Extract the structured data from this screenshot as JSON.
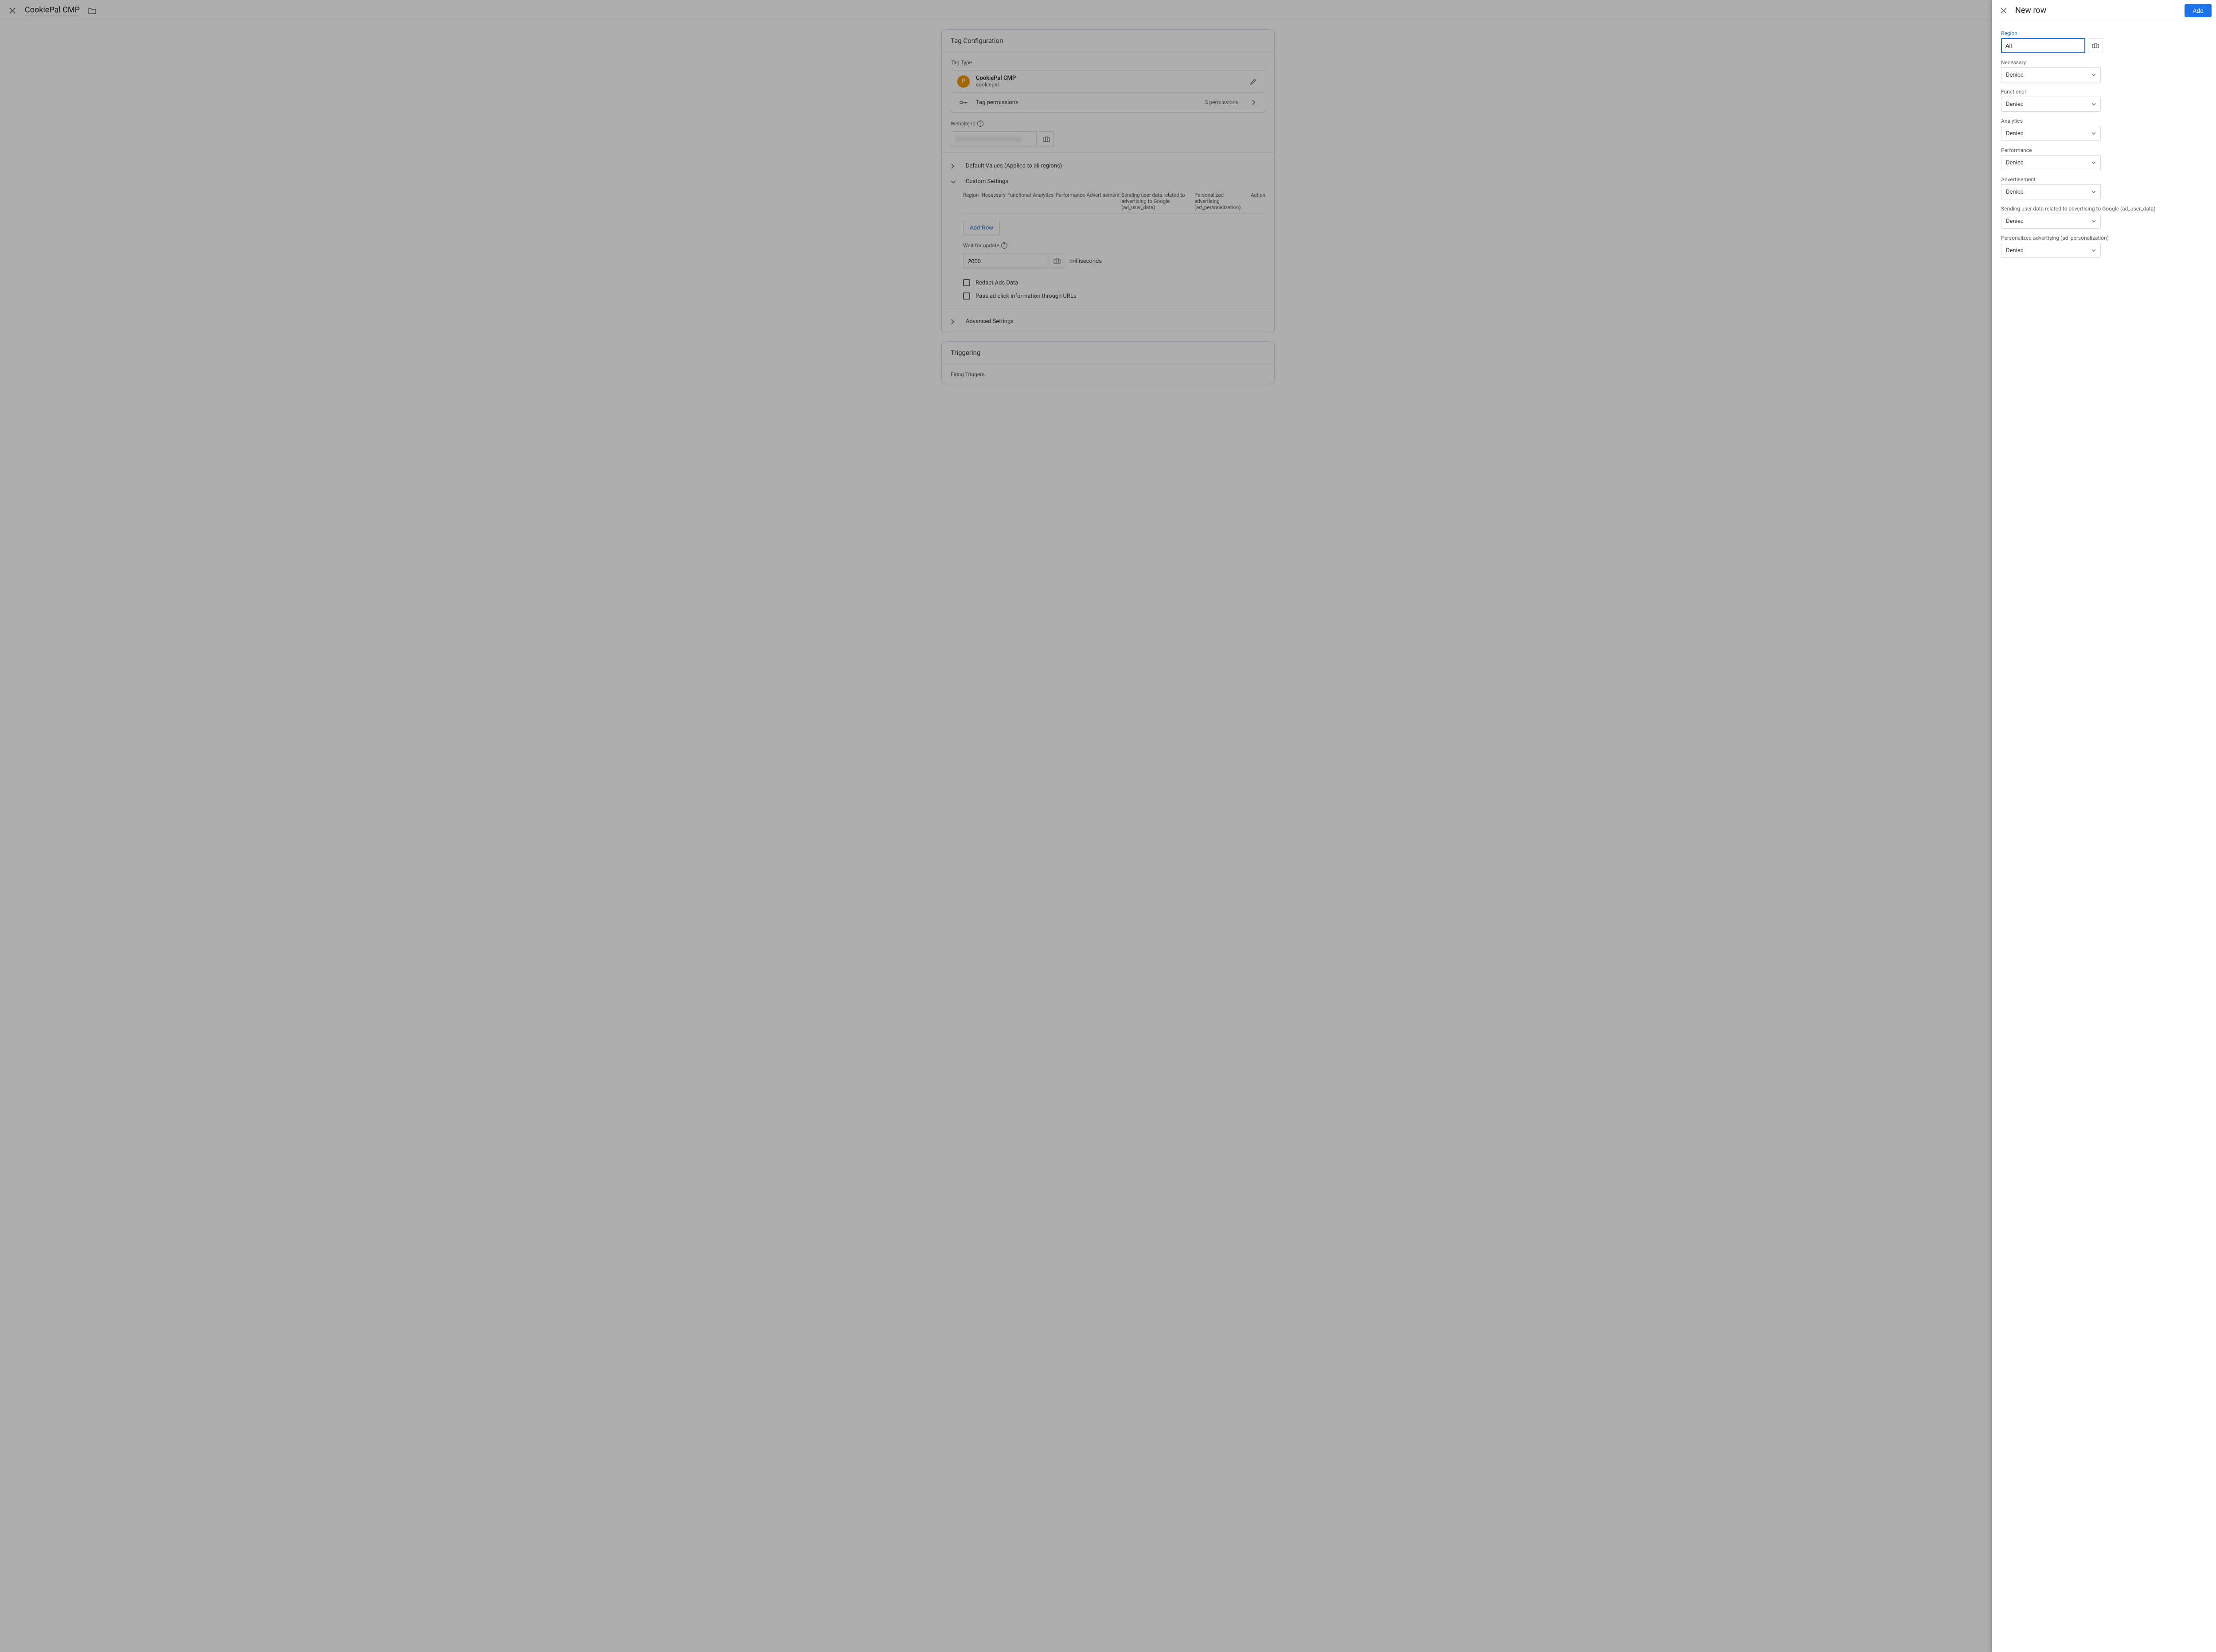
{
  "header": {
    "title": "CookiePal CMP"
  },
  "tag_config": {
    "heading": "Tag Configuration",
    "tag_type_label": "Tag Type",
    "tag_name": "CookiePal CMP",
    "tag_vendor": "cookiepal",
    "tag_letter": "P",
    "permissions_label": "Tag permissions",
    "permissions_count": "5 permissions",
    "website_id_label": "Website Id",
    "website_id_value": "xxxxxxxxxxxxxxxxxxxxxxx",
    "default_values_label": "Default Values (Applied to all regions)",
    "custom_settings_label": "Custom Settings",
    "table_headers": {
      "region": "Region",
      "necessary": "Necessary",
      "functional": "Functional",
      "analytics": "Analytics",
      "performance": "Performance",
      "advertisement": "Advertisement",
      "ad_user_data": "Sending user data related to advertising to Google (ad_user_data)",
      "ad_personalization": "Personalized advertising (ad_personalization)",
      "action": "Action"
    },
    "add_row_label": "Add Row",
    "wait_for_update_label": "Wait for update",
    "wait_for_update_value": "2000",
    "milliseconds": "milliseconds",
    "redact_ads_label": "Redact Ads Data",
    "pass_ad_click_label": "Pass ad click information through URLs",
    "advanced_settings_label": "Advanced Settings"
  },
  "triggering": {
    "heading": "Triggering",
    "firing_label": "Firing Triggers"
  },
  "panel": {
    "title": "New row",
    "add_btn": "Add",
    "region_label": "Region",
    "region_value": "All",
    "fields": [
      {
        "label": "Necessary",
        "value": "Denied"
      },
      {
        "label": "Functional",
        "value": "Denied"
      },
      {
        "label": "Analytics",
        "value": "Denied"
      },
      {
        "label": "Performance",
        "value": "Denied"
      },
      {
        "label": "Advertisement",
        "value": "Denied"
      },
      {
        "label": "Sending user data related to advertising to Google (ad_user_data)",
        "value": "Denied"
      },
      {
        "label": "Personalized advertising (ad_personalization)",
        "value": "Denied"
      }
    ]
  }
}
